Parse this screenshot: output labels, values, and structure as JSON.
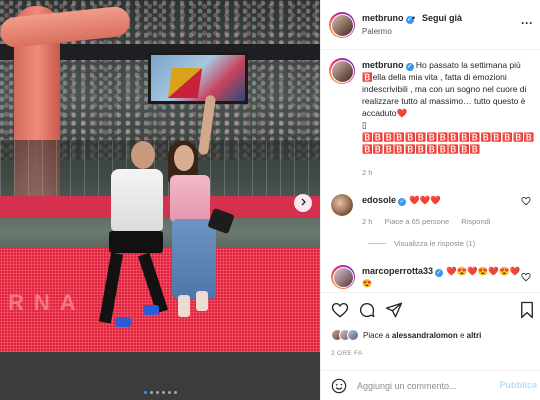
{
  "post": {
    "username": "metbruno",
    "follow_label": "Segui già",
    "location": "Palermo",
    "more_label": "···",
    "separator": "•",
    "caption_text": "Ho passato la settimana più 🅱️ella della mia vita , fatta di emozioni indescrivibili , ma con un sogno nel cuore di realizzare tutto al massimo… tutto questo è accaduto",
    "caption_trailing": "▯",
    "caption_boxes": "🅱️🅱️🅱️🅱️🅱️🅱️🅱️🅱️🅱️🅱️🅱️🅱️🅱️🅱️🅱️🅱️🅱️🅱️🅱️🅱️🅱️🅱️🅱️🅱️🅱️🅱️🅱️",
    "caption_time": "2 h",
    "led_wall_text": "RNA"
  },
  "comments": [
    {
      "username": "edosole",
      "text": "❤️❤️❤️",
      "time": "2 h",
      "likes_label": "Piace a 65 persone",
      "reply_label": "Rispondi",
      "view_replies_label": "Visualizza le risposte (1)"
    },
    {
      "username": "marcoperrotta33",
      "text": "❤️😍❤️😍❤️😍❤️",
      "emoji_line": "😍"
    }
  ],
  "likes": {
    "prefix": "Piace a ",
    "user": "alessandralomon",
    "middle": " e ",
    "others": "altri"
  },
  "date_label": "2 ORE FA",
  "add_comment": {
    "placeholder": "Aggiungi un commento...",
    "publish_label": "Pubblica"
  },
  "carousel": {
    "total": 6,
    "active_index": 0
  },
  "colors": {
    "verified": "#3897f0",
    "heart": "#ed4956",
    "publish_disabled": "#b2dffc",
    "led_red": "#d8233c"
  },
  "icons": [
    "verified-icon",
    "more-options-icon",
    "heart-icon",
    "comment-icon",
    "share-icon",
    "bookmark-icon",
    "emoji-icon",
    "chevron-right-icon"
  ]
}
